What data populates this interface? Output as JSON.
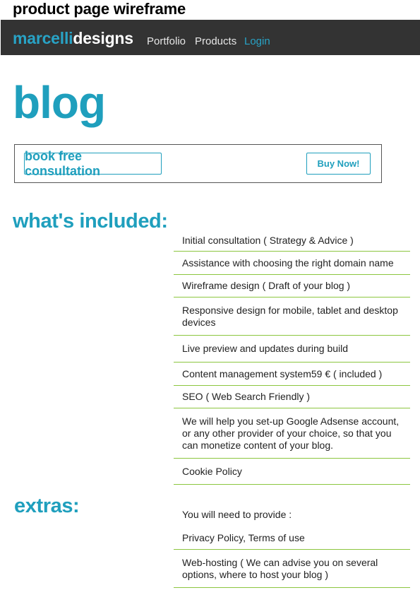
{
  "wireframe_title": "product page wireframe",
  "navbar": {
    "brand_part1": "marcelli",
    "brand_part2": "designs",
    "links": [
      "Portfolio",
      "Products",
      "Login"
    ]
  },
  "page_title": "blog",
  "cta": {
    "consult_label": "book free consultation",
    "buy_label": "Buy Now!"
  },
  "included": {
    "heading": "what's included:",
    "items": [
      "Initial consultation ( Strategy & Advice )",
      "Assistance with choosing the right domain name",
      "Wireframe design ( Draft of your blog )",
      "Responsive design for mobile, tablet and desktop devices",
      "Live preview and updates during build",
      "Content management system59 € ( included )",
      "SEO ( Web Search Friendly )",
      "We will help you set-up Google Adsense account, or any other provider of your choice, so that you can monetize content of your blog.",
      "Cookie Policy"
    ]
  },
  "extras": {
    "heading": "extras:",
    "items": [
      "You will need to provide :",
      "Privacy Policy, Terms of use",
      "Web-hosting ( We can advise you on several options, where to host your blog )"
    ]
  },
  "colors": {
    "accent": "#1f9fbd",
    "navbar_bg": "#333333",
    "divider": "#8cc63f"
  }
}
